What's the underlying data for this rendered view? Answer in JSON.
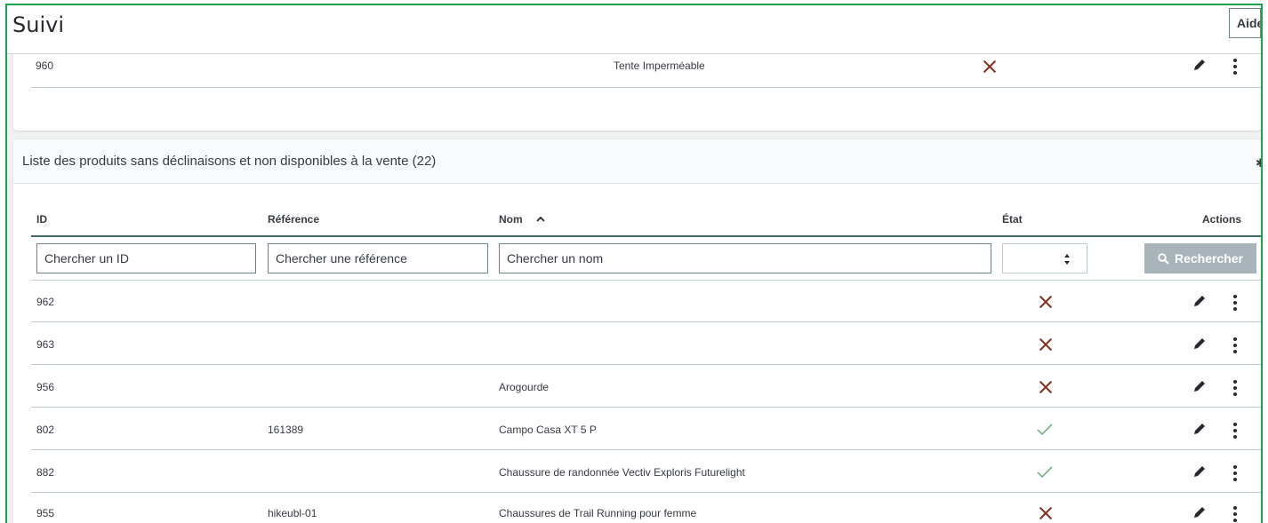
{
  "header": {
    "title": "Suivi",
    "help_label": "Aide"
  },
  "top_card": {
    "rows": [
      {
        "id": "960",
        "name": "Tente Imperméable",
        "state": "inactive"
      }
    ]
  },
  "list": {
    "title": "Liste des produits sans déclinaisons et non disponibles à la vente (22)",
    "columns": {
      "id": "ID",
      "reference": "Référence",
      "name": "Nom",
      "state": "État",
      "actions": "Actions"
    },
    "filters": {
      "id_placeholder": "Chercher un ID",
      "reference_placeholder": "Chercher une référence",
      "name_placeholder": "Chercher un nom",
      "state_value": "",
      "search_label": "Rechercher"
    },
    "rows": [
      {
        "id": "962",
        "reference": "",
        "name": "",
        "state": "inactive"
      },
      {
        "id": "963",
        "reference": "",
        "name": "",
        "state": "inactive"
      },
      {
        "id": "956",
        "reference": "",
        "name": "Arogourde",
        "state": "inactive"
      },
      {
        "id": "802",
        "reference": "161389",
        "name": "Campo Casa XT 5 P",
        "state": "active"
      },
      {
        "id": "882",
        "reference": "",
        "name": "Chaussure de randonnée Vectiv Exploris Futurelight",
        "state": "active"
      },
      {
        "id": "955",
        "reference": "hikeubl-01",
        "name": "Chaussures de Trail Running pour femme",
        "state": "inactive"
      }
    ]
  },
  "icons": {
    "state_active": "check-icon",
    "state_inactive": "cross-icon",
    "edit": "pencil-icon",
    "more": "kebab-menu-icon",
    "search": "search-icon",
    "sort": "chevron-up-icon",
    "select": "select-arrows-icon"
  },
  "colors": {
    "inactive_cross": "#8a2e1f",
    "active_check": "#70b580",
    "search_button": "#a8b4b9",
    "frame_border": "#1aa34a"
  }
}
